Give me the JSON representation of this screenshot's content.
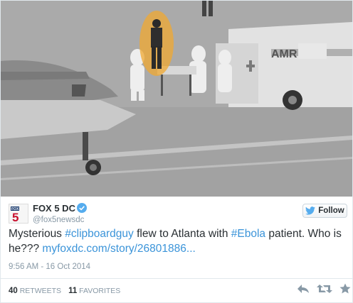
{
  "tweet": {
    "author_name": "FOX 5 DC",
    "handle": "@fox5newsdc",
    "follow_label": "Follow",
    "text": {
      "part1": "Mysterious ",
      "hashtag1": "#clipboardguy",
      "part2": " flew to Atlanta with ",
      "hashtag2": "#Ebola",
      "part3": " patient. Who is he??? ",
      "link": "myfoxdc.com/story/26801886..."
    },
    "timestamp": "9:56 AM - 16 Oct 2014",
    "retweets_count": "40",
    "retweets_label": "RETWEETS",
    "favorites_count": "11",
    "favorites_label": "FAVORITES",
    "avatar_text": "FOX 5",
    "photo_ambulance_text": "AMR"
  },
  "colors": {
    "link": "#3b94d9",
    "verified": "#55acee",
    "highlight": "#f0a830"
  },
  "icons": [
    "verified-badge-icon",
    "twitter-bird-icon",
    "reply-icon",
    "retweet-icon",
    "favorite-star-icon"
  ]
}
